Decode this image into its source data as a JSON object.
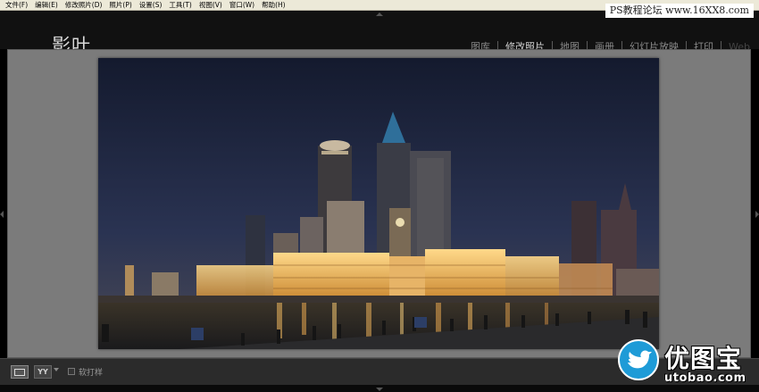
{
  "menubar": {
    "items": [
      "文件(F)",
      "编辑(E)",
      "修改照片(D)",
      "照片(P)",
      "设置(S)",
      "工具(T)",
      "视图(V)",
      "窗口(W)",
      "帮助(H)"
    ]
  },
  "watermark_top": "PS教程论坛 www.16XX8.com",
  "identity_plate": "影叶",
  "modules": {
    "library": "图库",
    "develop": "修改照片",
    "map": "地图",
    "book": "画册",
    "slideshow": "幻灯片放映",
    "print": "打印",
    "web": "Web"
  },
  "active_module": "修改照片",
  "toolbar": {
    "before_after_label": "YY",
    "soft_proof_label": "软打样"
  },
  "logo": {
    "name": "优图宝",
    "url": "utobao.com"
  },
  "colors": {
    "work_area": "#7b7b7b",
    "panel": "#111111",
    "logo_blue": "#1e9bd7"
  }
}
